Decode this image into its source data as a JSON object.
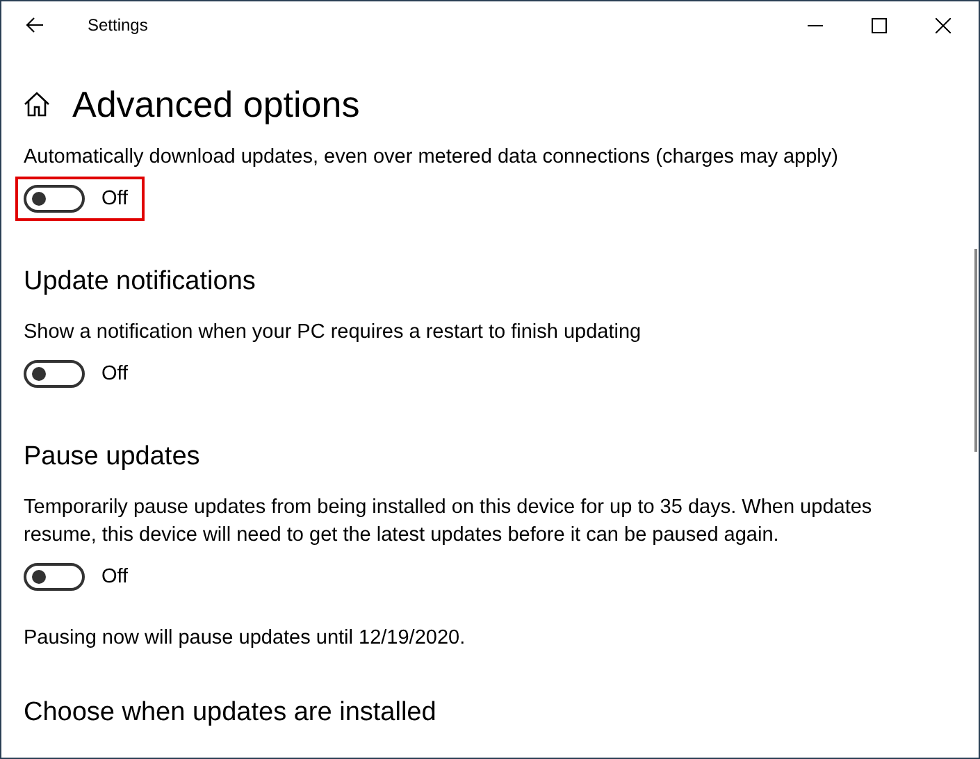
{
  "window": {
    "title": "Settings"
  },
  "page": {
    "title": "Advanced options"
  },
  "sections": [
    {
      "description": "Automatically download updates, even over metered data connections (charges may apply)",
      "toggle": {
        "on": false,
        "label": "Off",
        "highlighted": true
      }
    },
    {
      "heading": "Update notifications",
      "description": "Show a notification when your PC requires a restart to finish updating",
      "toggle": {
        "on": false,
        "label": "Off",
        "highlighted": false
      }
    },
    {
      "heading": "Pause updates",
      "description": "Temporarily pause updates from being installed on this device for up to 35 days. When updates resume, this device will need to get the latest updates before it can be paused again.",
      "toggle": {
        "on": false,
        "label": "Off",
        "highlighted": false
      },
      "note": "Pausing now will pause updates until 12/19/2020."
    },
    {
      "heading": "Choose when updates are installed"
    }
  ]
}
